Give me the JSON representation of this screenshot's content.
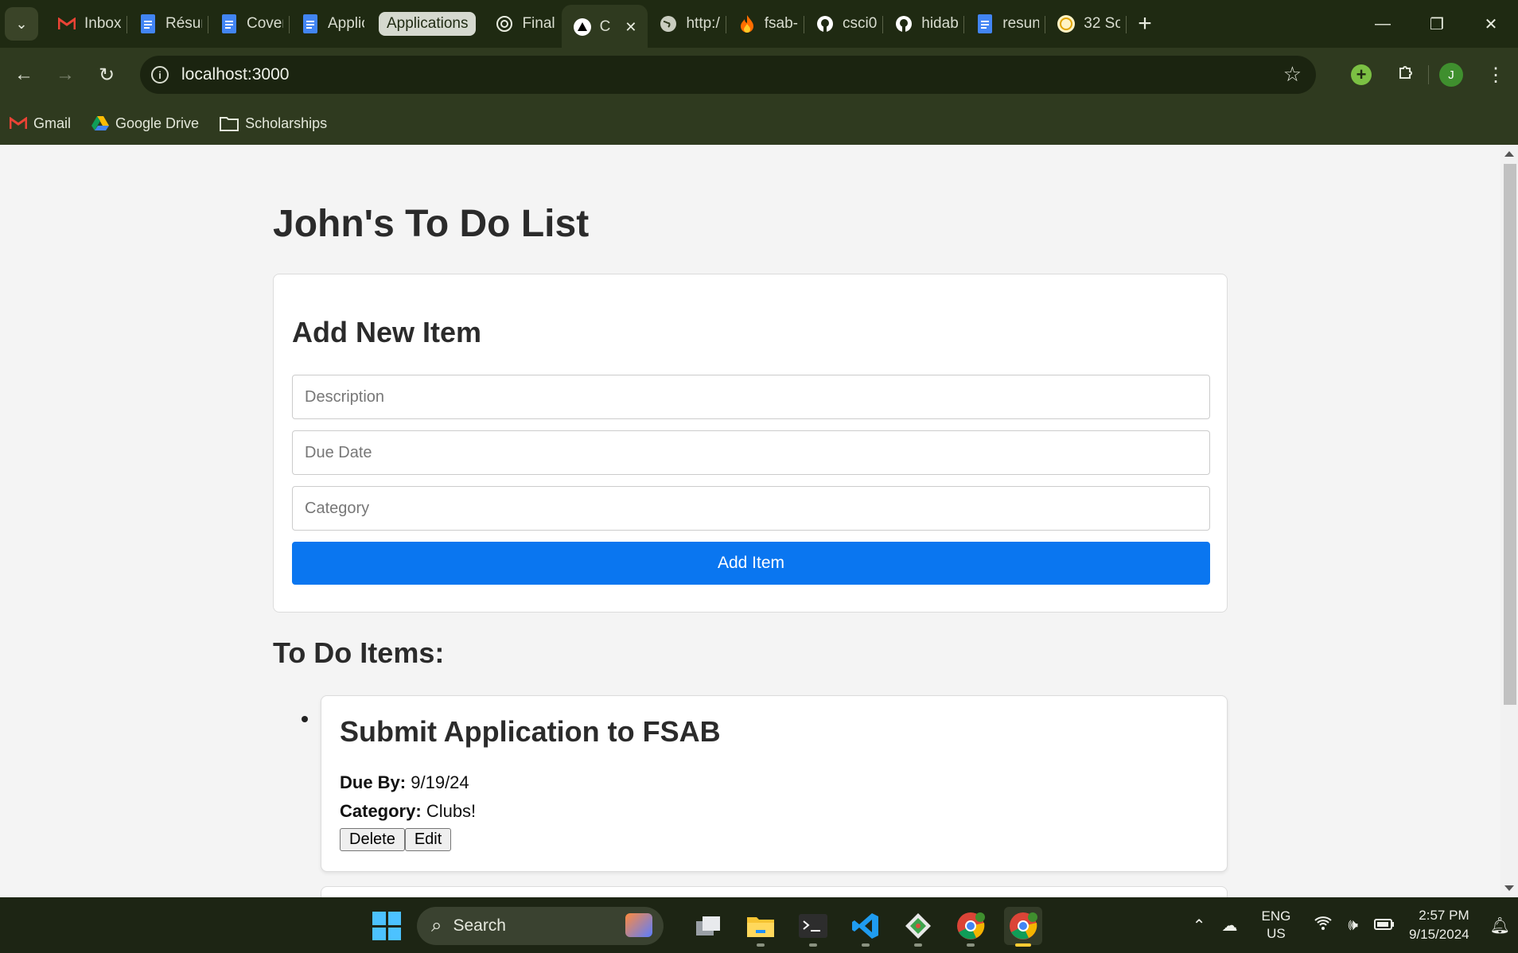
{
  "browser": {
    "tabs": [
      {
        "title": "Inbox",
        "icon": "gmail-icon"
      },
      {
        "title": "Résumé",
        "icon": "docs-icon"
      },
      {
        "title": "Cover",
        "icon": "docs-icon"
      },
      {
        "title": "Applic",
        "icon": "docs-icon"
      }
    ],
    "tab_group_label": "Applications",
    "tabs_after_group": [
      {
        "title": "Final",
        "icon": "chatgpt-icon"
      }
    ],
    "active_tab": {
      "title": "C",
      "icon": "nextjs-icon"
    },
    "tabs_after_active": [
      {
        "title": "http:/",
        "icon": "globe-icon"
      },
      {
        "title": "fsab-",
        "icon": "firebase-icon"
      },
      {
        "title": "csci0",
        "icon": "github-icon"
      },
      {
        "title": "hidab",
        "icon": "github-icon"
      },
      {
        "title": "resun",
        "icon": "docs-icon"
      },
      {
        "title": "32 So",
        "icon": "bitcoin-icon"
      }
    ],
    "url": "localhost:3000",
    "profile_initial": "J",
    "bookmarks": [
      {
        "label": "Gmail",
        "icon": "gmail-icon"
      },
      {
        "label": "Google Drive",
        "icon": "drive-icon"
      },
      {
        "label": "Scholarships",
        "icon": "folder-icon"
      }
    ]
  },
  "page": {
    "title": "John's To Do List",
    "form": {
      "heading": "Add New Item",
      "description_placeholder": "Description",
      "due_date_placeholder": "Due Date",
      "category_placeholder": "Category",
      "description_value": "",
      "due_date_value": "",
      "category_value": "",
      "submit_label": "Add Item"
    },
    "list_heading": "To Do Items:",
    "items": [
      {
        "title": "Submit Application to FSAB",
        "due_label": "Due By:",
        "due": "9/19/24",
        "category_label": "Category:",
        "category": "Clubs!",
        "delete_label": "Delete",
        "edit_label": "Edit"
      }
    ]
  },
  "taskbar": {
    "search_label": "Search",
    "language": "ENG",
    "region": "US",
    "time": "2:57 PM",
    "date": "9/15/2024"
  },
  "colors": {
    "accent": "#0a76f0",
    "chrome_dark": "#1f2a12",
    "chrome_toolbar": "#2f3a1f",
    "page_bg": "#f4f4f4"
  }
}
